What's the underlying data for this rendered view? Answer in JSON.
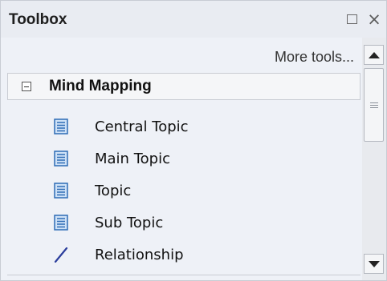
{
  "window": {
    "title": "Toolbox",
    "maximize_icon": "maximize-icon",
    "close_icon": "close-icon",
    "close_glyph": "×"
  },
  "toolbar": {
    "more_tools_label": "More tools..."
  },
  "group": {
    "label": "Mind Mapping",
    "expanded": true,
    "items": [
      {
        "label": "Central Topic",
        "icon": "topic-icon"
      },
      {
        "label": "Main Topic",
        "icon": "topic-icon"
      },
      {
        "label": "Topic",
        "icon": "topic-icon"
      },
      {
        "label": "Sub Topic",
        "icon": "topic-icon"
      },
      {
        "label": "Relationship",
        "icon": "relationship-icon"
      }
    ]
  },
  "colors": {
    "topic_icon_border": "#2e6cb5",
    "topic_icon_fill": "#cfe2f7",
    "relationship_icon": "#2a3d9c"
  }
}
